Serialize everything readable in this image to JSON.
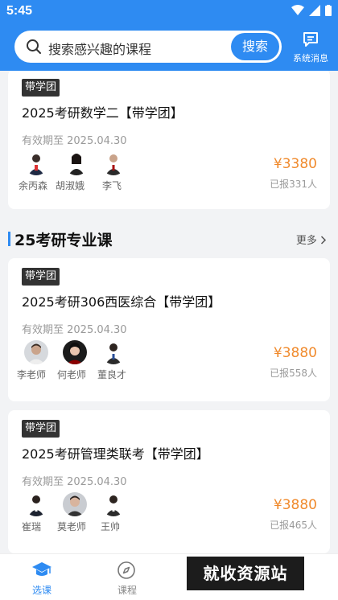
{
  "status_bar": {
    "time": "5:45"
  },
  "header": {
    "search_placeholder": "搜索感兴趣的课程",
    "search_button": "搜索",
    "messages_label": "系统消息"
  },
  "courses_top": [
    {
      "tag": "带学团",
      "title": "2025考研数学二【带学团】",
      "expiry": "有效期至 2025.04.30",
      "teachers": [
        "余丙森",
        "胡淑娥",
        "李飞"
      ],
      "price": "¥3380",
      "enrolled": "已报331人"
    }
  ],
  "section": {
    "title": "25考研专业课",
    "more": "更多"
  },
  "courses": [
    {
      "tag": "带学团",
      "title": "2025考研306西医综合【带学团】",
      "expiry": "有效期至 2025.04.30",
      "teachers": [
        "李老师",
        "何老师",
        "董良才"
      ],
      "price": "¥3880",
      "enrolled": "已报558人"
    },
    {
      "tag": "带学团",
      "title": "2025考研管理类联考【带学团】",
      "expiry": "有效期至 2025.04.30",
      "teachers": [
        "崔瑞",
        "莫老师",
        "王帅"
      ],
      "price": "¥3880",
      "enrolled": "已报465人"
    }
  ],
  "tabbar": {
    "tabs": [
      {
        "label": "选课",
        "active": true
      },
      {
        "label": "课程",
        "active": false
      }
    ]
  },
  "watermark": "就收资源站",
  "colors": {
    "primary": "#2e8bf2",
    "price": "#f08a2c",
    "tag_bg": "#333333"
  }
}
